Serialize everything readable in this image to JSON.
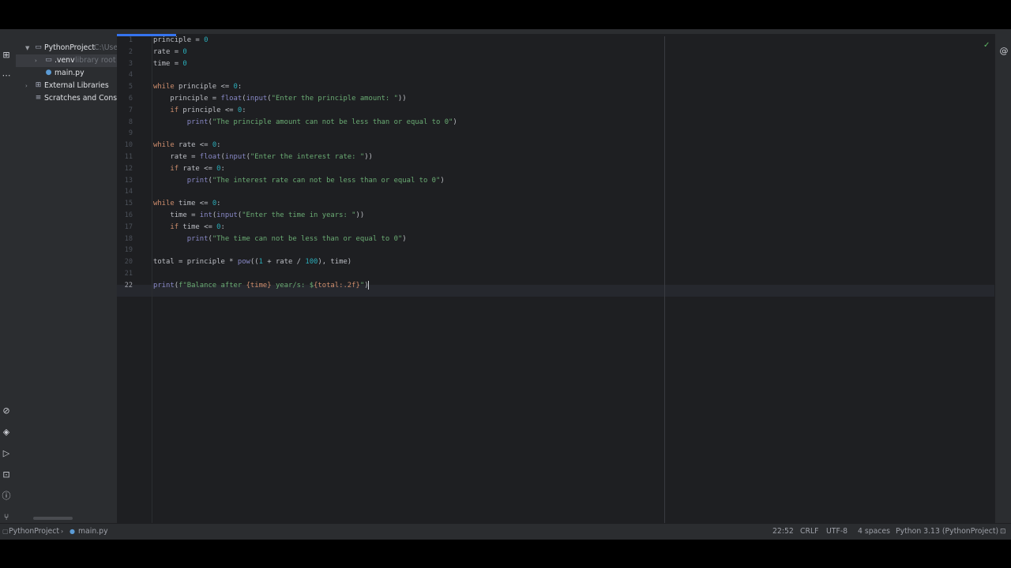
{
  "project": {
    "root": {
      "name": "PythonProject",
      "path": "C:\\Use"
    },
    "items": [
      {
        "name": ".venv",
        "hint": "library root"
      },
      {
        "name": "main.py"
      },
      {
        "name": "External Libraries"
      },
      {
        "name": "Scratches and Consol"
      }
    ]
  },
  "editor": {
    "file": "main.py",
    "line_numbers": [
      "1",
      "2",
      "3",
      "4",
      "5",
      "6",
      "7",
      "8",
      "9",
      "10",
      "11",
      "12",
      "13",
      "14",
      "15",
      "16",
      "17",
      "18",
      "19",
      "20",
      "21",
      "22"
    ],
    "current_line": "22",
    "lines": [
      "principle = 0",
      "rate = 0",
      "time = 0",
      "",
      "while principle <= 0:",
      "    principle = float(input(\"Enter the principle amount: \"))",
      "    if principle <= 0:",
      "        print(\"The principle amount can not be less than or equal to 0\")",
      "",
      "while rate <= 0:",
      "    rate = float(input(\"Enter the interest rate: \"))",
      "    if rate <= 0:",
      "        print(\"The interest rate can not be less than or equal to 0\")",
      "",
      "while time <= 0:",
      "    time = int(input(\"Enter the time in years: \"))",
      "    if time <= 0:",
      "        print(\"The time can not be less than or equal to 0\")",
      "",
      "total = principle * pow((1 + rate / 100), time)",
      "",
      "print(f\"Balance after {time} year/s: ${total:.2f}\")"
    ]
  },
  "statusbar": {
    "breadcrumb_project": "PythonProject",
    "breadcrumb_file": "main.py",
    "position": "22:52",
    "line_ending": "CRLF",
    "encoding": "UTF-8",
    "indent": "4 spaces",
    "interpreter": "Python 3.13 (PythonProject)"
  },
  "colors": {
    "background": "#1e1f22",
    "panel": "#2b2d30",
    "accent": "#3574f0",
    "keyword": "#cf8e6d",
    "string": "#6aab73",
    "number": "#2aacb8"
  },
  "icons": [
    "folder-icon",
    "python-file-icon",
    "library-icon",
    "scratches-icon",
    "check-icon",
    "lock-icon"
  ]
}
